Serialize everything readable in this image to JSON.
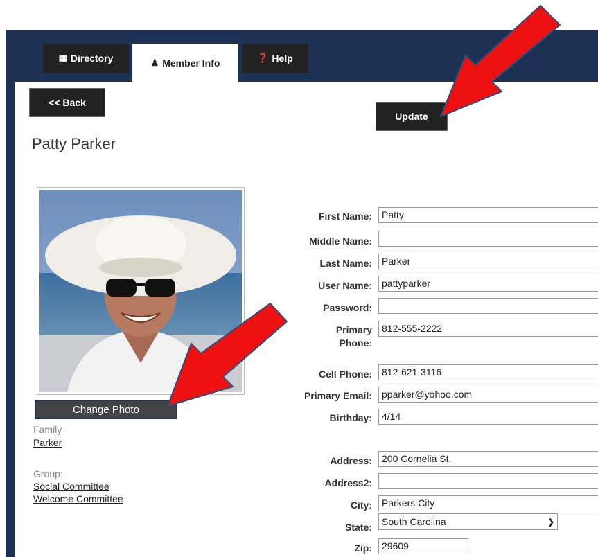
{
  "tabs": [
    {
      "label": "Directory",
      "icon": "grid-icon"
    },
    {
      "label": "Member Info",
      "icon": "user-icon"
    },
    {
      "label": "Help",
      "icon": "question-circle-icon"
    }
  ],
  "buttons": {
    "back": "<< Back",
    "update": "Update",
    "change_photo": "Change Photo"
  },
  "member": {
    "full_name": "Patty Parker",
    "family_label": "Family",
    "family_link": "Parker",
    "group_label": "Group:",
    "groups": [
      "Social Committee",
      "Welcome Committee"
    ]
  },
  "form": {
    "first_name": {
      "label": "First Name:",
      "value": "Patty"
    },
    "middle_name": {
      "label": "Middle Name:",
      "value": ""
    },
    "last_name": {
      "label": "Last Name:",
      "value": "Parker"
    },
    "user_name": {
      "label": "User Name:",
      "value": "pattyparker"
    },
    "password": {
      "label": "Password:",
      "value": ""
    },
    "primary_phone": {
      "label_line1": "Primary",
      "label_line2": "Phone:",
      "value": "812-555-2222"
    },
    "cell_phone": {
      "label": "Cell Phone:",
      "value": "812-621-3116"
    },
    "primary_email": {
      "label": "Primary Email:",
      "value": "pparker@yohoo.com"
    },
    "birthday": {
      "label": "Birthday:",
      "value": "4/14"
    },
    "address": {
      "label": "Address:",
      "value": "200 Cornelia St."
    },
    "address2": {
      "label": "Address2:",
      "value": ""
    },
    "city": {
      "label": "City:",
      "value": "Parkers City"
    },
    "state": {
      "label": "State:",
      "value": "South Carolina"
    },
    "zip": {
      "label": "Zip:",
      "value": "29609"
    }
  },
  "colors": {
    "frame": "#1d3154",
    "tab_dark": "#222222",
    "annotation_arrow": "#ee1111"
  }
}
